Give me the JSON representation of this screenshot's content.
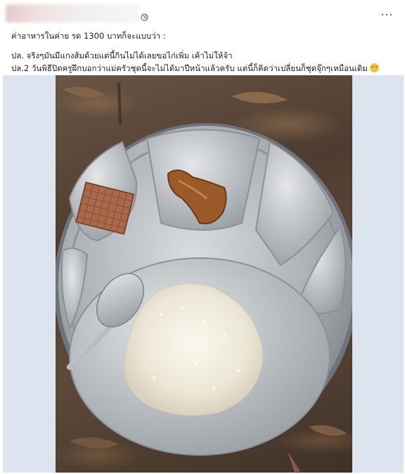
{
  "post": {
    "caption_line1": "ค่าอาหารในค่าย รด 1300 บาทก็จะแบบว่า :",
    "caption_line2": "ปล. จริงๆมันมีแกงส้มด้วยแต่นี้กินไม่ได้เลยขอไก่เพิ่ม เค้าไม่ให้จ้า",
    "caption_line3": "ปล.2 วันพิธีปิดครูฝึกบอกว่าแม่ครัวชุดนี้จะไม่ได้มาปีหน้าแล้วครับ แต่นี้ก็คิดว่าเปลี่ยนก็ชุดจุ๊กๆเหมือนเดิม",
    "more_icon": "…",
    "icons": {
      "globe": "globe-icon",
      "more": "more-options-icon",
      "emoji": "smiling-emoji-icon"
    }
  },
  "colors": {
    "photo_frame_bg": "#dbe4ef",
    "text": "#1c1e21",
    "muted": "#65676b"
  }
}
